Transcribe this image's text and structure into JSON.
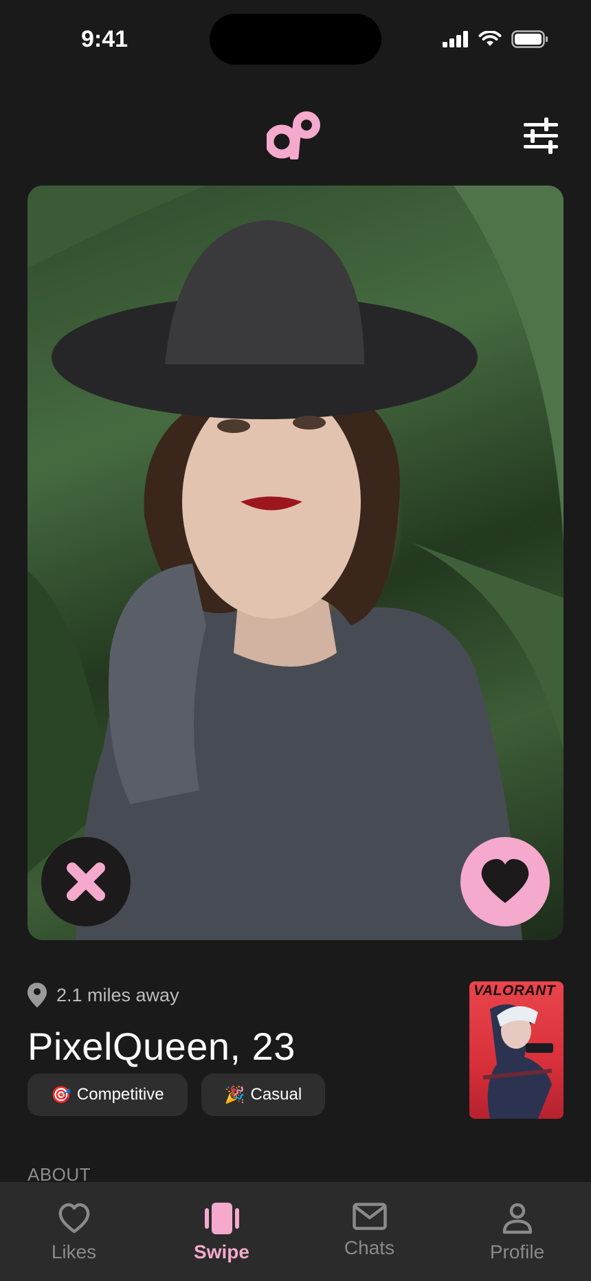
{
  "status": {
    "time": "9:41"
  },
  "colors": {
    "accent": "#f5a9cc",
    "background": "#1a1a1a",
    "tab_bar": "#2b2b2b",
    "tag_bg": "#2e2e2e"
  },
  "header": {
    "logo_icon": "app-logo-icon",
    "filter_icon": "sliders-icon"
  },
  "card": {
    "photo": "profile-photo",
    "pass_icon": "close-icon",
    "like_icon": "heart-icon"
  },
  "profile": {
    "distance": "2.1 miles away",
    "name": "PixelQueen, 23",
    "tags": [
      {
        "emoji": "🎯",
        "label": "Competitive"
      },
      {
        "emoji": "🎉",
        "label": "Casual"
      }
    ],
    "game_title": "VALORANT"
  },
  "about_heading": "ABOUT",
  "tabs": [
    {
      "label": "Likes",
      "icon": "heart-outline-icon",
      "active": false
    },
    {
      "label": "Swipe",
      "icon": "cards-icon",
      "active": true
    },
    {
      "label": "Chats",
      "icon": "mail-icon",
      "active": false
    },
    {
      "label": "Profile",
      "icon": "person-icon",
      "active": false
    }
  ]
}
